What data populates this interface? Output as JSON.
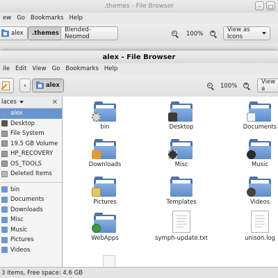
{
  "bg_window": {
    "title": ".themes - File Browser",
    "menu": [
      "ew",
      "Go",
      "Bookmarks",
      "Help"
    ],
    "path_buttons": [
      "alex",
      ".themes",
      "Blended-Neomod"
    ],
    "zoom": "100%",
    "view_select": "View as Icons"
  },
  "fg_window": {
    "title": "alex - File Browser",
    "menu": [
      "ile",
      "Edit",
      "View",
      "Go",
      "Bookmarks",
      "Help"
    ],
    "back_glyph": "‹",
    "path_button": "alex",
    "zoom": "100%",
    "view_select": "View a"
  },
  "sidebar": {
    "header": "laces",
    "close_glyph": "✕",
    "places": [
      {
        "label": "alex",
        "icon": "home-folder-icon",
        "selected": true
      },
      {
        "label": "Desktop",
        "icon": "desktop-icon"
      },
      {
        "label": "File System",
        "icon": "drive-icon"
      },
      {
        "label": "19.5 GB Volume",
        "icon": "drive-icon"
      },
      {
        "label": "HP_RECOVERY",
        "icon": "drive-icon"
      },
      {
        "label": "OS_TOOLS",
        "icon": "drive-icon"
      },
      {
        "label": "Deleted Items",
        "icon": "trash-icon"
      }
    ],
    "bookmarks": [
      {
        "label": "bin",
        "icon": "folder-icon"
      },
      {
        "label": "Documents",
        "icon": "folder-icon"
      },
      {
        "label": "Downloads",
        "icon": "folder-icon"
      },
      {
        "label": "Misc",
        "icon": "folder-icon"
      },
      {
        "label": "Music",
        "icon": "folder-icon"
      },
      {
        "label": "Pictures",
        "icon": "folder-icon"
      },
      {
        "label": "Videos",
        "icon": "folder-icon"
      }
    ]
  },
  "files": [
    {
      "name": "bin",
      "type": "folder",
      "emblem": "gear"
    },
    {
      "name": "Desktop",
      "type": "folder",
      "emblem": "desk"
    },
    {
      "name": "Documents",
      "type": "folder",
      "emblem": "doc"
    },
    {
      "name": "Downloads",
      "type": "folder",
      "emblem": "down"
    },
    {
      "name": "Misc",
      "type": "folder",
      "emblem": "film"
    },
    {
      "name": "Music",
      "type": "folder",
      "emblem": "music"
    },
    {
      "name": "Pictures",
      "type": "folder",
      "emblem": "pic"
    },
    {
      "name": "Templates",
      "type": "folder",
      "emblem": ""
    },
    {
      "name": "Videos",
      "type": "folder",
      "emblem": "vid"
    },
    {
      "name": "WebApps",
      "type": "folder",
      "emblem": "web"
    },
    {
      "name": "symph-update.txt",
      "type": "text"
    },
    {
      "name": "unison.log",
      "type": "text"
    }
  ],
  "status": "3 items, Free space: 4.6 GB"
}
